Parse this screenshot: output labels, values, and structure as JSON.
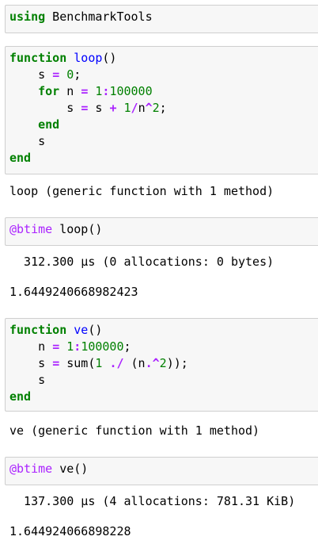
{
  "cells": [
    {
      "id": "c1",
      "input_lines": [
        [
          {
            "t": "kw",
            "v": "using"
          },
          {
            "t": "plain",
            "v": " BenchmarkTools"
          }
        ]
      ]
    },
    {
      "id": "c2",
      "input_lines": [
        [
          {
            "t": "kw",
            "v": "function"
          },
          {
            "t": "plain",
            "v": " "
          },
          {
            "t": "fn",
            "v": "loop"
          },
          {
            "t": "plain",
            "v": "()"
          }
        ],
        [
          {
            "t": "plain",
            "v": "    s "
          },
          {
            "t": "op",
            "v": "="
          },
          {
            "t": "plain",
            "v": " "
          },
          {
            "t": "num",
            "v": "0"
          },
          {
            "t": "plain",
            "v": ";"
          }
        ],
        [
          {
            "t": "plain",
            "v": "    "
          },
          {
            "t": "kw",
            "v": "for"
          },
          {
            "t": "plain",
            "v": " n "
          },
          {
            "t": "op",
            "v": "="
          },
          {
            "t": "plain",
            "v": " "
          },
          {
            "t": "num",
            "v": "1"
          },
          {
            "t": "op",
            "v": ":"
          },
          {
            "t": "num",
            "v": "100000"
          }
        ],
        [
          {
            "t": "plain",
            "v": "        s "
          },
          {
            "t": "op",
            "v": "="
          },
          {
            "t": "plain",
            "v": " s "
          },
          {
            "t": "op",
            "v": "+"
          },
          {
            "t": "plain",
            "v": " "
          },
          {
            "t": "num",
            "v": "1"
          },
          {
            "t": "op",
            "v": "/"
          },
          {
            "t": "plain",
            "v": "n"
          },
          {
            "t": "op",
            "v": "^"
          },
          {
            "t": "num",
            "v": "2"
          },
          {
            "t": "plain",
            "v": ";"
          }
        ],
        [
          {
            "t": "plain",
            "v": "    "
          },
          {
            "t": "kw",
            "v": "end"
          }
        ],
        [
          {
            "t": "plain",
            "v": "    s"
          }
        ],
        [
          {
            "t": "kw",
            "v": "end"
          }
        ]
      ],
      "output": "loop (generic function with 1 method)"
    },
    {
      "id": "c3",
      "input_lines": [
        [
          {
            "t": "macro",
            "v": "@btime"
          },
          {
            "t": "plain",
            "v": " loop()"
          }
        ]
      ],
      "output_lines": [
        "  312.300 µs (0 allocations: 0 bytes)",
        "",
        "1.6449240668982423"
      ]
    },
    {
      "id": "c4",
      "input_lines": [
        [
          {
            "t": "kw",
            "v": "function"
          },
          {
            "t": "plain",
            "v": " "
          },
          {
            "t": "fn",
            "v": "ve"
          },
          {
            "t": "plain",
            "v": "()"
          }
        ],
        [
          {
            "t": "plain",
            "v": "    n "
          },
          {
            "t": "op",
            "v": "="
          },
          {
            "t": "plain",
            "v": " "
          },
          {
            "t": "num",
            "v": "1"
          },
          {
            "t": "op",
            "v": ":"
          },
          {
            "t": "num",
            "v": "100000"
          },
          {
            "t": "plain",
            "v": ";"
          }
        ],
        [
          {
            "t": "plain",
            "v": "    s "
          },
          {
            "t": "op",
            "v": "="
          },
          {
            "t": "plain",
            "v": " sum("
          },
          {
            "t": "num",
            "v": "1"
          },
          {
            "t": "plain",
            "v": " "
          },
          {
            "t": "op",
            "v": "./"
          },
          {
            "t": "plain",
            "v": " (n"
          },
          {
            "t": "op",
            "v": ".^"
          },
          {
            "t": "num",
            "v": "2"
          },
          {
            "t": "plain",
            "v": "));"
          }
        ],
        [
          {
            "t": "plain",
            "v": "    s"
          }
        ],
        [
          {
            "t": "kw",
            "v": "end"
          }
        ]
      ],
      "output": "ve (generic function with 1 method)"
    },
    {
      "id": "c5",
      "input_lines": [
        [
          {
            "t": "macro",
            "v": "@btime"
          },
          {
            "t": "plain",
            "v": " ve()"
          }
        ]
      ],
      "output_lines": [
        "  137.300 µs (4 allocations: 781.31 KiB)",
        "",
        "1.644924066898228"
      ]
    }
  ],
  "colors": {
    "keyword": "#008000",
    "operator": "#aa22ff",
    "number": "#008000",
    "function_name": "#0000ff",
    "macro": "#aa22ff",
    "cell_background": "#f7f7f7",
    "cell_border": "#cfcfcf"
  }
}
